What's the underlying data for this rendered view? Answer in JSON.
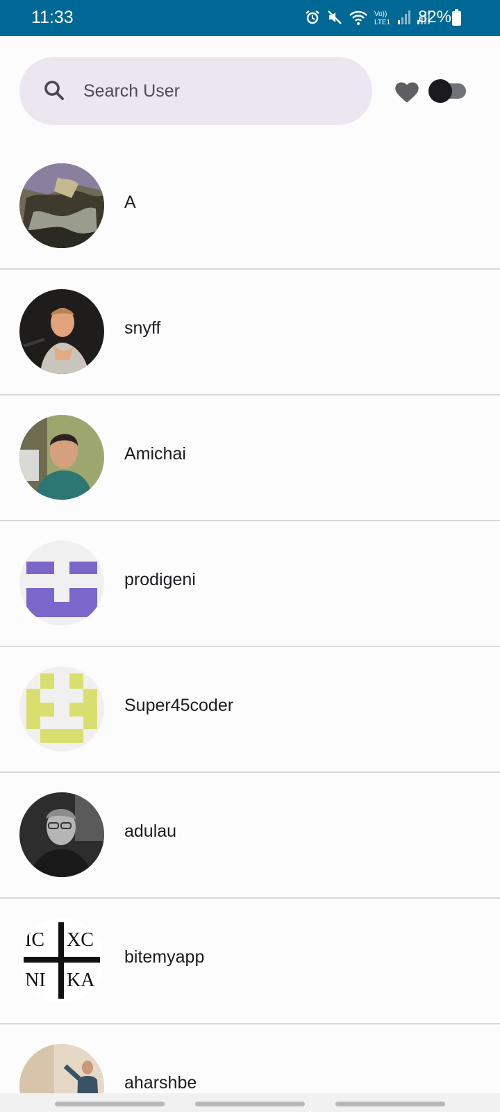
{
  "status_bar": {
    "time": "11:33",
    "battery": "82%",
    "icons": [
      "alarm-icon",
      "mute-icon",
      "wifi-icon",
      "volte-icon",
      "signal-icon",
      "signal-icon",
      "battery-icon"
    ],
    "volte_label": "Vo))\nLTE1"
  },
  "search": {
    "placeholder": "Search User",
    "value": ""
  },
  "header_actions": {
    "favorite_icon": "heart-icon",
    "toggle_state": "off"
  },
  "users": [
    {
      "name": "A",
      "avatar": "painting-avatar"
    },
    {
      "name": "snyff",
      "avatar": "photo-avatar"
    },
    {
      "name": "Amichai",
      "avatar": "photo-avatar"
    },
    {
      "name": "prodigeni",
      "avatar": "identicon-avatar"
    },
    {
      "name": "Super45coder",
      "avatar": "identicon-avatar"
    },
    {
      "name": "adulau",
      "avatar": "photo-avatar"
    },
    {
      "name": "bitemyapp",
      "avatar": "icxc-nika-avatar",
      "avatar_text": [
        "IC",
        "XC",
        "NI",
        "KA"
      ]
    },
    {
      "name": "aharshbe",
      "avatar": "photo-avatar"
    }
  ],
  "colors": {
    "status_bar": "#006895",
    "search_bg": "#ebe6ef",
    "identicon_purple": "#7b66c9",
    "identicon_yellow": "#d9df6e"
  }
}
